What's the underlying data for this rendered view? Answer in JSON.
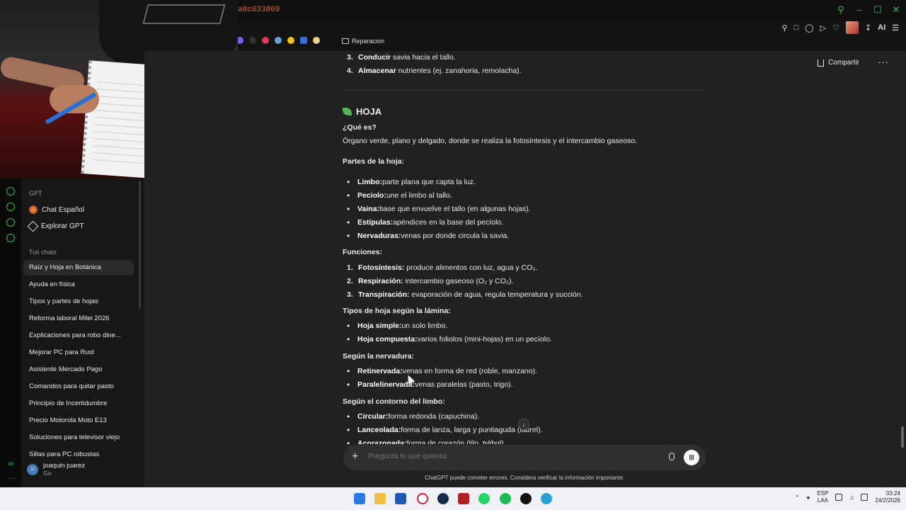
{
  "browser": {
    "url_fragment": "a8c033869",
    "bookmark_folder": "Reparacion",
    "ai_label": "AI"
  },
  "sidebar": {
    "gpt_section": "GPT",
    "gpts": [
      {
        "label": "Chat Español",
        "icon": "chat-espanol-icon"
      },
      {
        "label": "Explorar GPT",
        "icon": "cube-icon"
      }
    ],
    "chats_section": "Tus chats",
    "chats": [
      "Raíz y Hoja en Botánica",
      "Ayuda en física",
      "Tipos y partes de hojas",
      "Reforma laboral Milei 2026",
      "Explicaciones para robo dine...",
      "Mejorar PC para Rust",
      "Asistente Mercado Pago",
      "Comandos para quitar pasto",
      "Principio de Incertidumbre",
      "Precio Motorola Moto E13",
      "Soluciones para televisor viejo",
      "Sillas para PC robustas"
    ],
    "active_chat_index": 0,
    "user": {
      "initials": "JJ",
      "name": "joaquin juarez",
      "plan": "Go"
    },
    "rail_label": "ox"
  },
  "header": {
    "share_label": "Compartir",
    "more_label": "···"
  },
  "content": {
    "prev_items": [
      {
        "n": "3.",
        "bold": "Conducir",
        "rest": " savia hacia el tallo."
      },
      {
        "n": "4.",
        "bold": "Almacenar",
        "rest": " nutrientes (ej. zanahoria, remolacha)."
      }
    ],
    "heading": "HOJA",
    "que_es_label": "¿Qué es?",
    "que_es_text": "Órgano verde, plano y delgado, donde se realiza la fotosíntesis y el intercambio gaseoso.",
    "partes_label": "Partes de la hoja:",
    "partes": [
      {
        "bold": "Limbo:",
        "rest": " parte plana que capta la luz."
      },
      {
        "bold": "Peciolo:",
        "rest": " une el limbo al tallo."
      },
      {
        "bold": "Vaina:",
        "rest": " base que envuelve el tallo (en algunas hojas)."
      },
      {
        "bold": "Estípulas:",
        "rest": " apéndices en la base del pecíolo."
      },
      {
        "bold": "Nervaduras:",
        "rest": " venas por donde circula la savia."
      }
    ],
    "funciones_label": "Funciones:",
    "funciones": [
      {
        "n": "1.",
        "bold": "Fotosíntesis:",
        "rest": " produce alimentos con luz, agua y CO₂."
      },
      {
        "n": "2.",
        "bold": "Respiración:",
        "rest": " intercambio gaseoso (O₂ y CO₂)."
      },
      {
        "n": "3.",
        "bold": "Transpiración:",
        "rest": " evaporación de agua, regula temperatura y succión."
      }
    ],
    "lamina_label": "Tipos de hoja según la lámina:",
    "lamina": [
      {
        "bold": "Hoja simple:",
        "rest": " un solo limbo."
      },
      {
        "bold": "Hoja compuesta:",
        "rest": " varios foliolos (mini-hojas) en un pecíolo."
      }
    ],
    "nervadura_label": "Según la nervadura:",
    "nervadura": [
      {
        "bold": "Retinervada:",
        "rest": " venas en forma de red (roble, manzano)."
      },
      {
        "bold": "Paralelinervada:",
        "rest": " venas paralelas (pasto, trigo)."
      }
    ],
    "contorno_label": "Según el contorno del limbo:",
    "contorno": [
      {
        "bold": "Circular:",
        "rest": " forma redonda (capuchina)."
      },
      {
        "bold": "Lanceolada:",
        "rest": " forma de lanza, larga y puntiaguda (laurel)."
      },
      {
        "bold": "Acorazonada:",
        "rest": " forma de corazón (tilo, trébol)."
      }
    ]
  },
  "composer": {
    "placeholder": "Pregunta lo que quieras",
    "disclaimer": "ChatGPT puede cometer errores. Considera verificar la información importante."
  },
  "taskbar": {
    "lang_1": "ESP",
    "lang_2": "LAA",
    "time": "03:24",
    "date": "24/2/2026"
  }
}
